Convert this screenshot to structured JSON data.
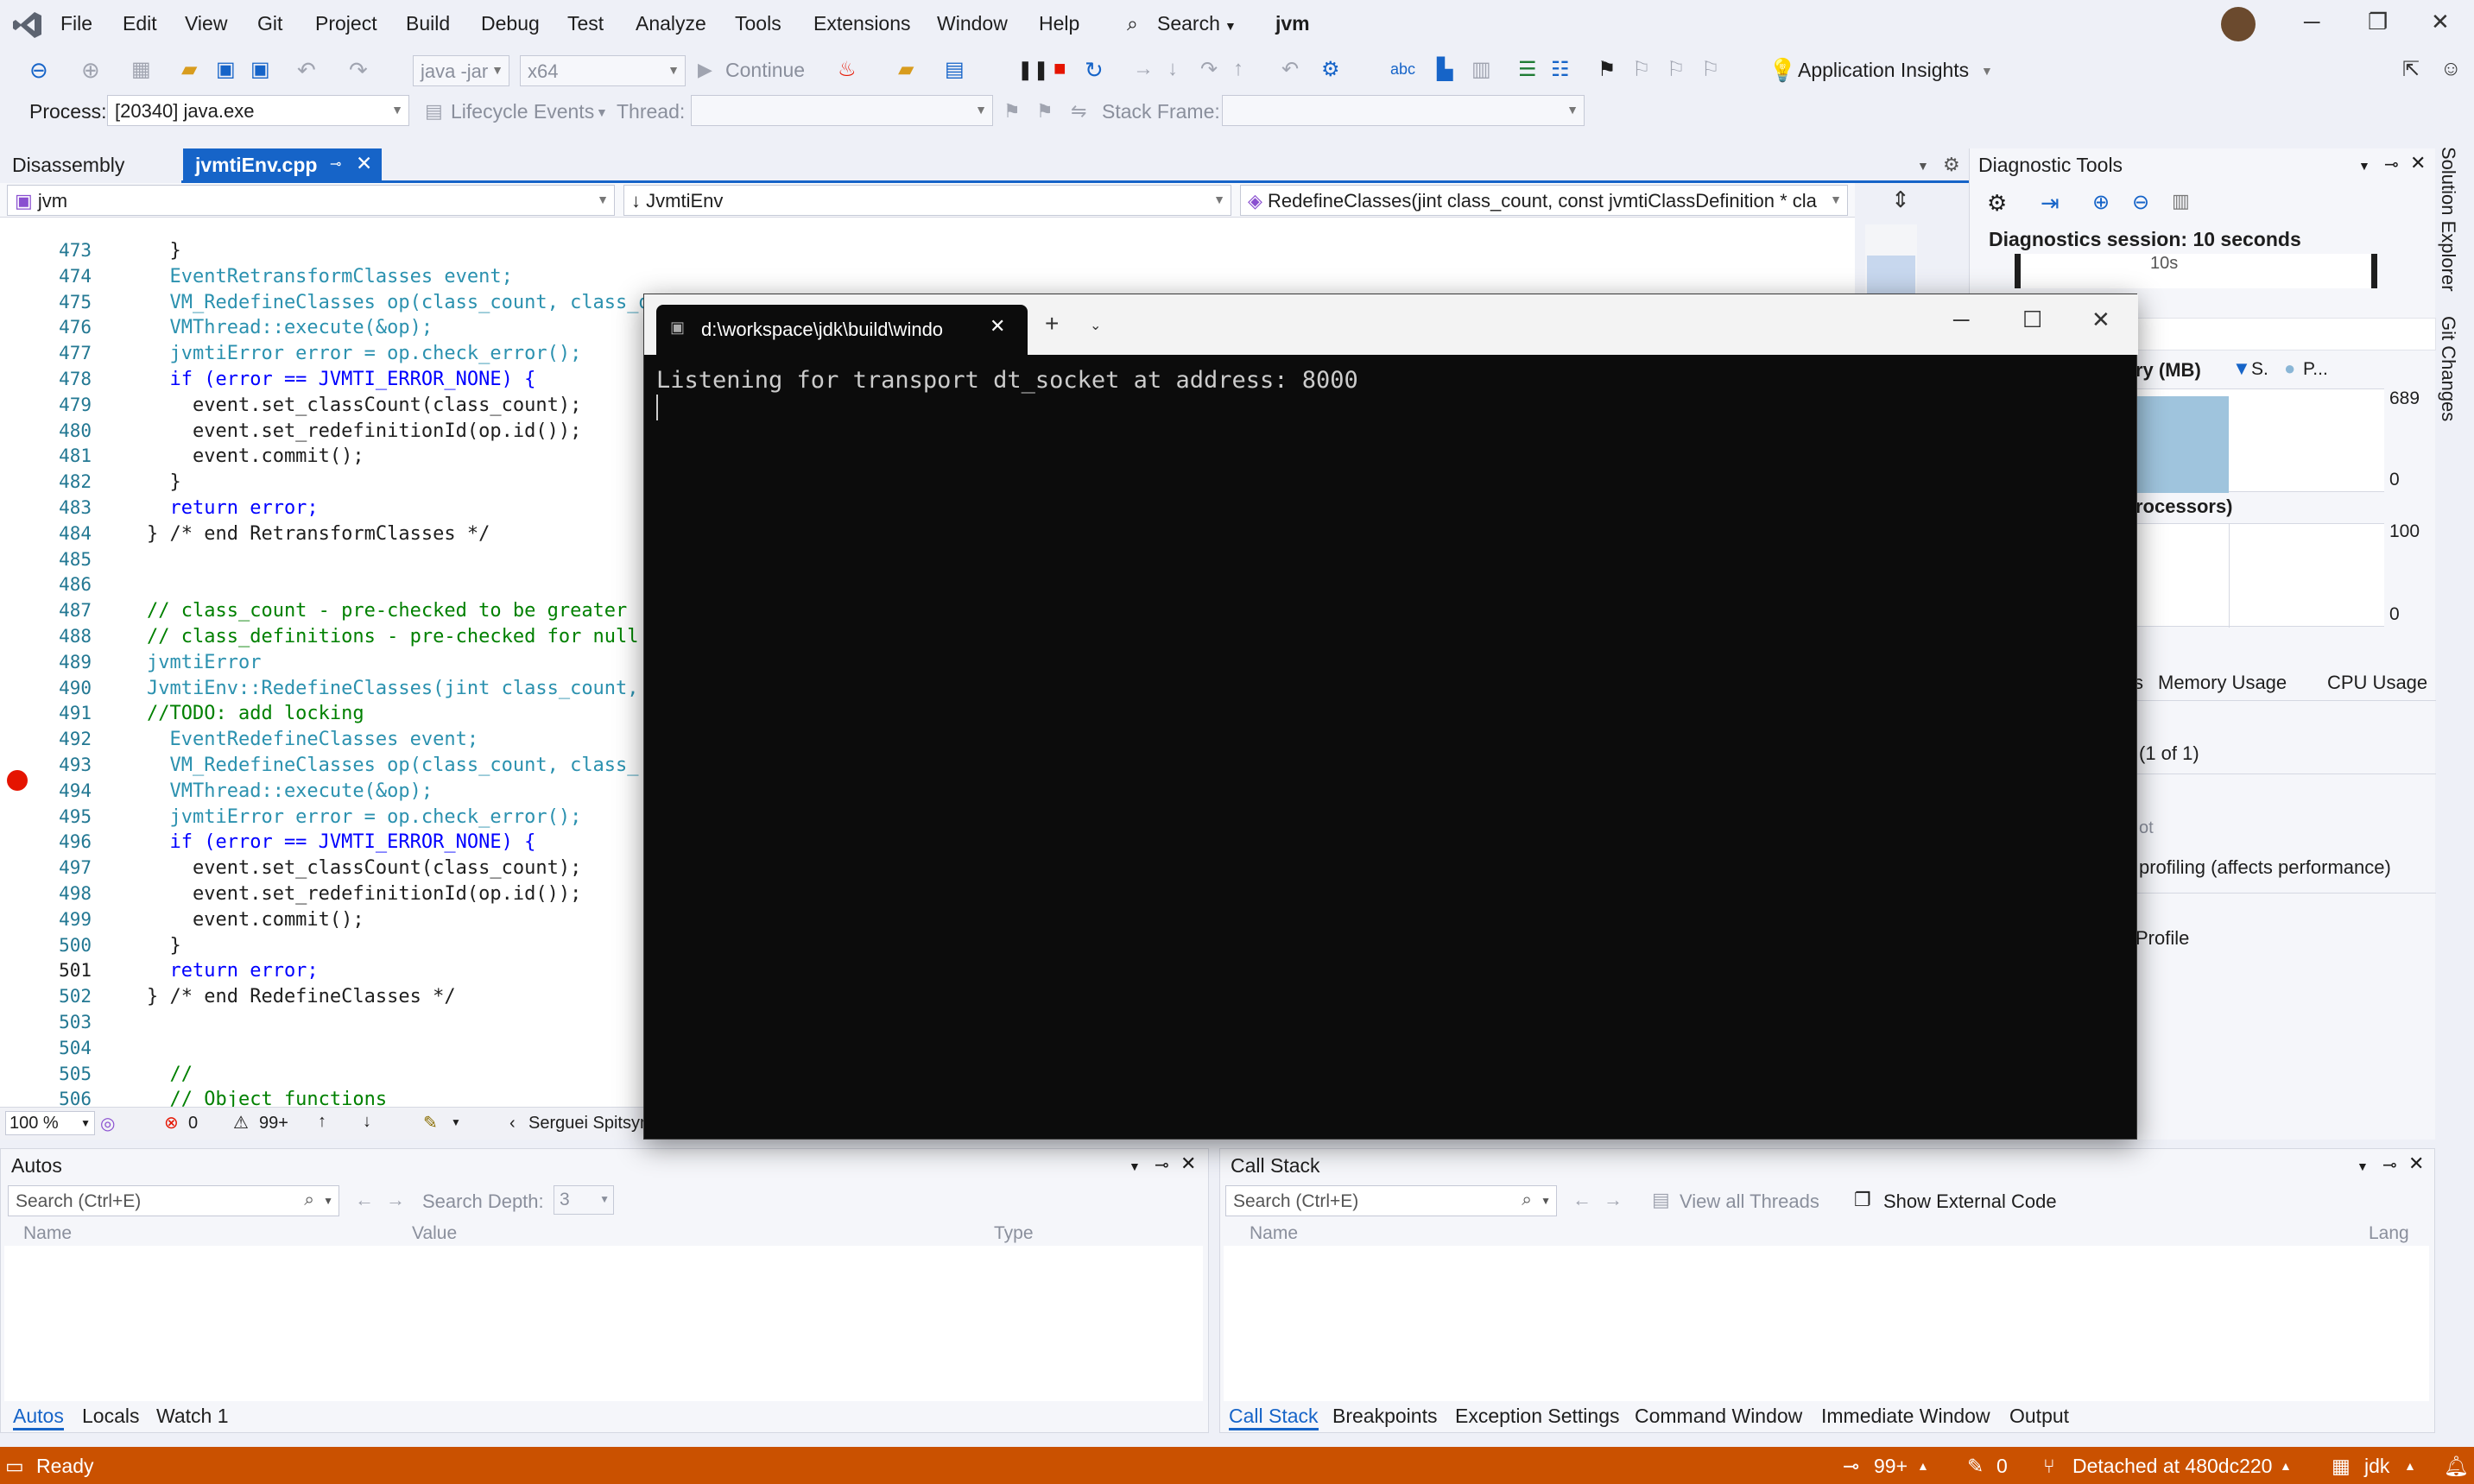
{
  "menu": {
    "items": [
      "File",
      "Edit",
      "View",
      "Git",
      "Project",
      "Build",
      "Debug",
      "Test",
      "Analyze",
      "Tools",
      "Extensions",
      "Window",
      "Help"
    ],
    "search_label": "Search",
    "solution_name": "jvm"
  },
  "toolbar": {
    "config_combo": "java -jar",
    "platform_combo": "x64",
    "continue_label": "Continue",
    "app_insights_label": "Application Insights"
  },
  "process_bar": {
    "process_label": "Process:",
    "process_value": "[20340] java.exe",
    "lifecycle_label": "Lifecycle Events",
    "thread_label": "Thread:",
    "stack_frame_label": "Stack Frame:"
  },
  "doc_tabs": {
    "disassembly": "Disassembly",
    "active_file": "jvmtiEnv.cpp"
  },
  "nav_bar": {
    "project": "jvm",
    "scope": "JvmtiEnv",
    "member": "RedefineClasses(jint class_count, const jvmtiClassDefinition * cla"
  },
  "code_lines": [
    {
      "n": "473",
      "t": "  }"
    },
    {
      "n": "474",
      "t": "  EventRetransformClasses event;"
    },
    {
      "n": "475",
      "t": "  VM_RedefineClasses op(class_count, class_definitions, jvmti_class_load_kind_retransform);"
    },
    {
      "n": "476",
      "t": "  VMThread::execute(&op);"
    },
    {
      "n": "477",
      "t": "  jvmtiError error = op.check_error();"
    },
    {
      "n": "478",
      "t": "  if (error == JVMTI_ERROR_NONE) {"
    },
    {
      "n": "479",
      "t": "    event.set_classCount(class_count);"
    },
    {
      "n": "480",
      "t": "    event.set_redefinitionId(op.id());"
    },
    {
      "n": "481",
      "t": "    event.commit();"
    },
    {
      "n": "482",
      "t": "  }"
    },
    {
      "n": "483",
      "t": "  return error;"
    },
    {
      "n": "484",
      "t": "} /* end RetransformClasses */"
    },
    {
      "n": "485",
      "t": ""
    },
    {
      "n": "486",
      "t": ""
    },
    {
      "n": "487",
      "t": "// class_count - pre-checked to be greater"
    },
    {
      "n": "488",
      "t": "// class_definitions - pre-checked for null"
    },
    {
      "n": "489",
      "t": "jvmtiError"
    },
    {
      "n": "490",
      "t": "JvmtiEnv::RedefineClasses(jint class_count,"
    },
    {
      "n": "491",
      "t": "//TODO: add locking"
    },
    {
      "n": "492",
      "t": "  EventRedefineClasses event;"
    },
    {
      "n": "493",
      "t": "  VM_RedefineClasses op(class_count, class_"
    },
    {
      "n": "494",
      "t": "  VMThread::execute(&op);"
    },
    {
      "n": "495",
      "t": "  jvmtiError error = op.check_error();"
    },
    {
      "n": "496",
      "t": "  if (error == JVMTI_ERROR_NONE) {"
    },
    {
      "n": "497",
      "t": "    event.set_classCount(class_count);"
    },
    {
      "n": "498",
      "t": "    event.set_redefinitionId(op.id());"
    },
    {
      "n": "499",
      "t": "    event.commit();"
    },
    {
      "n": "500",
      "t": "  }"
    },
    {
      "n": "501",
      "t": "  return error;"
    },
    {
      "n": "502",
      "t": "} /* end RedefineClasses */"
    },
    {
      "n": "503",
      "t": ""
    },
    {
      "n": "504",
      "t": ""
    },
    {
      "n": "505",
      "t": "  //"
    },
    {
      "n": "506",
      "t": "  // Object functions"
    }
  ],
  "editor_status": {
    "zoom": "100 %",
    "errors": "0",
    "warnings": "99+",
    "author": "Serguei Spitsyn"
  },
  "diagnostic_tools": {
    "title": "Diagnostic Tools",
    "session": "Diagnostics session: 10 seconds",
    "timeline_tick": "10s",
    "memory_label": "ry (MB)",
    "legend_s": "S.",
    "legend_p": "P...",
    "mem_max": "689",
    "mem_min": "0",
    "cpu_label": "rocessors)",
    "cpu_max": "100",
    "cpu_min": "0",
    "tab_events": "s",
    "tab_memory": "Memory Usage",
    "tab_cpu": "CPU Usage",
    "count": "(1 of 1)",
    "snapshot_label": "ot",
    "profiling_label": "profiling (affects performance)",
    "profile_label": "Profile"
  },
  "right_strip": {
    "solution_explorer": "Solution Explorer",
    "git_changes": "Git Changes"
  },
  "autos": {
    "title": "Autos",
    "search_placeholder": "Search (Ctrl+E)",
    "search_depth_label": "Search Depth:",
    "search_depth_value": "3",
    "col_name": "Name",
    "col_value": "Value",
    "col_type": "Type",
    "tabs": [
      "Autos",
      "Locals",
      "Watch 1"
    ]
  },
  "call_stack": {
    "title": "Call Stack",
    "search_placeholder": "Search (Ctrl+E)",
    "view_all_threads": "View all Threads",
    "show_external": "Show External Code",
    "col_name": "Name",
    "col_lang": "Lang",
    "tabs": [
      "Call Stack",
      "Breakpoints",
      "Exception Settings",
      "Command Window",
      "Immediate Window",
      "Output"
    ]
  },
  "status_bar": {
    "ready": "Ready",
    "changes": "99+",
    "edits": "0",
    "git_state": "Detached at 480dc220",
    "repo": "jdk"
  },
  "terminal": {
    "tab_title": "d:\\workspace\\jdk\\build\\windo",
    "output": "Listening for transport dt_socket at address: 8000"
  },
  "colors": {
    "status_bar": "#ca5100",
    "accent": "#1664c8",
    "terminal_bg": "#0c0c0c",
    "breakpoint": "#e51400"
  }
}
